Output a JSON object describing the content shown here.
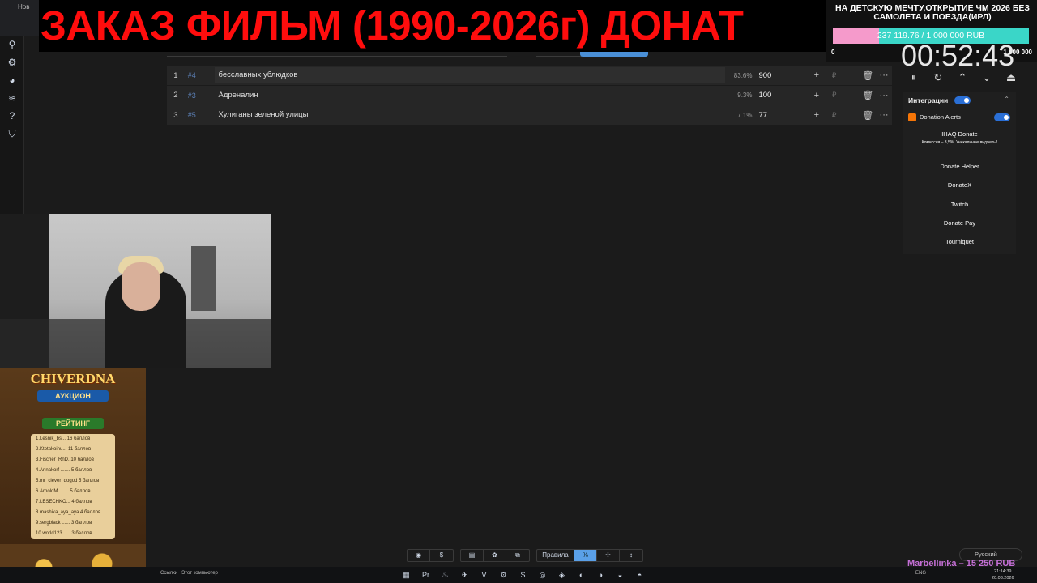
{
  "chrome": {
    "tab_label": "Нов"
  },
  "banner": {
    "text": "ЗАКАЗ ФИЛЬМ (1990-2026г) ДОНАТ"
  },
  "rail": {
    "icons": [
      "pin-icon",
      "gear-icon",
      "chart-icon",
      "layers-icon",
      "help-icon",
      "shield-icon"
    ]
  },
  "list": {
    "rows": [
      {
        "index": "1",
        "tag": "#4",
        "name": "бесславных ублюдков",
        "percent": "83.6%",
        "amount": "900",
        "currency": "₽"
      },
      {
        "index": "2",
        "tag": "#3",
        "name": "Адреналин",
        "percent": "9.3%",
        "amount": "100",
        "currency": "₽"
      },
      {
        "index": "3",
        "tag": "#5",
        "name": "Хулиганы зеленой улицы",
        "percent": "7.1%",
        "amount": "77",
        "currency": "₽"
      }
    ],
    "add_symbol": "+",
    "delete_symbol": "🗑",
    "more_symbol": "···"
  },
  "goal": {
    "title": "НА ДЕТСКУЮ МЕЧТУ,ОТКРЫТИЕ ЧМ 2026 БЕЗ САМОЛЕТА И ПОЕЗДА(ИРЛ)",
    "label": "237 119.76 / 1 000 000 RUB",
    "progress": 0.237,
    "min": "0",
    "max": "1 000 000",
    "colors": {
      "fill": "#f59acb",
      "remaining": "#3ad6c8"
    }
  },
  "timer": {
    "value": "00:52:43"
  },
  "controls": {
    "pause": "⏸",
    "restart": "↻",
    "up": "⌃",
    "down": "⌄",
    "eject": "⏏"
  },
  "integrations": {
    "title": "Интеграции",
    "donation_alerts": "Donation Alerts",
    "services": [
      {
        "name": "IHAQ Donate",
        "note": "Комиссия – 3,5%. Уникальные виджеты!",
        "color": "#2f89c9"
      },
      {
        "name": "Donate Helper",
        "color": "#1e2d5a"
      },
      {
        "name": "DonateX",
        "color": "#0e0e14"
      },
      {
        "name": "Twitch",
        "color": "#9146ff"
      },
      {
        "name": "Donate Pay",
        "color": "#4fbf5a"
      },
      {
        "name": "Tourniquet",
        "color": "#b9b13a"
      }
    ]
  },
  "poster": {
    "title": "CHIVERDNA",
    "sub1": "АУКЦИОН",
    "sub2": "РЕЙТИНГ",
    "entries": [
      "1.Lesnik_bs... 16 баллов",
      "2.Ktotakoinu... 11 баллов",
      "3.Fischer_RnD. 10 баллов",
      "4.Annakorf ....... 5 баллов",
      "5.mr_clever_dogod 5 баллов",
      "6.ArnoldM ....... 5 баллов",
      "7.LESECHKO... 4 баллов",
      "8.mashika_aya_aya 4 баллов",
      "9.sergblack ...... 3 баллов",
      "10.world123 ..... 3 баллов"
    ]
  },
  "bottom_toolbar": {
    "group1": [
      "github-icon",
      "$"
    ],
    "group2": [
      "doc-icon",
      "palette-icon",
      "copy-icon"
    ],
    "rules_label": "Правила",
    "group3": [
      "%",
      "✢",
      "↕"
    ]
  },
  "language": {
    "selected": "Русский"
  },
  "donor_line": "Marbellinka – 15 250 RUB",
  "taskbar": {
    "links": "Ссылки",
    "pc": "Этот компьютер",
    "tray": "ENG",
    "time": "21:14:39",
    "date": "20.03.2026"
  }
}
